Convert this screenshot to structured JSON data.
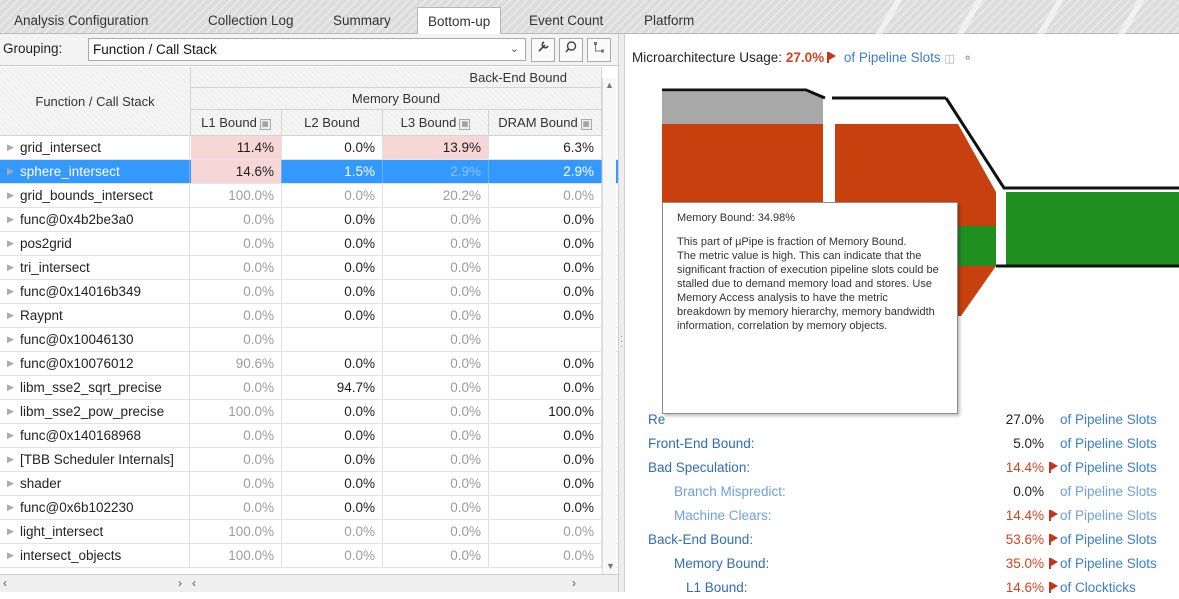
{
  "tabs": [
    {
      "label": "Analysis Configuration",
      "active": false
    },
    {
      "label": "Collection Log",
      "active": false
    },
    {
      "label": "Summary",
      "active": false
    },
    {
      "label": "Bottom-up",
      "active": true
    },
    {
      "label": "Event Count",
      "active": false
    },
    {
      "label": "Platform",
      "active": false
    }
  ],
  "grouping": {
    "label": "Grouping:",
    "value": "Function / Call Stack",
    "buttons": [
      "wrench-icon",
      "search-icon",
      "tree-icon"
    ]
  },
  "grid": {
    "header": {
      "name_col": "Function / Call Stack",
      "group1": "Back-End Bound",
      "group2": "Memory Bound",
      "columns": [
        "L1 Bound",
        "L2 Bound",
        "L3 Bound",
        "DRAM Bound"
      ]
    },
    "rows": [
      {
        "name": "grid_intersect",
        "values": [
          "11.4%",
          "0.0%",
          "13.9%",
          "6.3%"
        ],
        "selected": false,
        "highlight": [
          0,
          2
        ],
        "dim": []
      },
      {
        "name": "sphere_intersect",
        "values": [
          "14.6%",
          "1.5%",
          "2.9%",
          "2.9%"
        ],
        "selected": true,
        "highlight": [
          0
        ],
        "dim": [
          2
        ]
      },
      {
        "name": "grid_bounds_intersect",
        "values": [
          "100.0%",
          "0.0%",
          "20.2%",
          "0.0%"
        ],
        "selected": false,
        "highlight": [],
        "dim": [
          0,
          1,
          2,
          3
        ]
      },
      {
        "name": "func@0x4b2be3a0",
        "values": [
          "0.0%",
          "0.0%",
          "0.0%",
          "0.0%"
        ],
        "selected": false,
        "highlight": [],
        "dim": [
          0,
          2
        ]
      },
      {
        "name": "pos2grid",
        "values": [
          "0.0%",
          "0.0%",
          "0.0%",
          "0.0%"
        ],
        "selected": false,
        "highlight": [],
        "dim": [
          0,
          2
        ]
      },
      {
        "name": "tri_intersect",
        "values": [
          "0.0%",
          "0.0%",
          "0.0%",
          "0.0%"
        ],
        "selected": false,
        "highlight": [],
        "dim": [
          0,
          2
        ]
      },
      {
        "name": "func@0x14016b349",
        "values": [
          "0.0%",
          "0.0%",
          "0.0%",
          "0.0%"
        ],
        "selected": false,
        "highlight": [],
        "dim": [
          0,
          2
        ]
      },
      {
        "name": "Raypnt",
        "values": [
          "0.0%",
          "0.0%",
          "0.0%",
          "0.0%"
        ],
        "selected": false,
        "highlight": [],
        "dim": [
          0,
          2
        ]
      },
      {
        "name": "func@0x10046130",
        "values": [
          "0.0%",
          "",
          "0.0%",
          ""
        ],
        "selected": false,
        "highlight": [],
        "dim": [
          0,
          2
        ]
      },
      {
        "name": "func@0x10076012",
        "values": [
          "90.6%",
          "0.0%",
          "0.0%",
          "0.0%"
        ],
        "selected": false,
        "highlight": [],
        "dim": [
          0,
          2
        ]
      },
      {
        "name": "libm_sse2_sqrt_precise",
        "values": [
          "0.0%",
          "94.7%",
          "0.0%",
          "0.0%"
        ],
        "selected": false,
        "highlight": [],
        "dim": [
          0,
          2
        ]
      },
      {
        "name": "libm_sse2_pow_precise",
        "values": [
          "100.0%",
          "0.0%",
          "0.0%",
          "100.0%"
        ],
        "selected": false,
        "highlight": [],
        "dim": [
          0,
          2
        ]
      },
      {
        "name": "func@0x140168968",
        "values": [
          "0.0%",
          "0.0%",
          "0.0%",
          "0.0%"
        ],
        "selected": false,
        "highlight": [],
        "dim": [
          0,
          2
        ]
      },
      {
        "name": "[TBB Scheduler Internals]",
        "values": [
          "0.0%",
          "0.0%",
          "0.0%",
          "0.0%"
        ],
        "selected": false,
        "highlight": [],
        "dim": [
          0,
          2
        ]
      },
      {
        "name": "shader",
        "values": [
          "0.0%",
          "0.0%",
          "0.0%",
          "0.0%"
        ],
        "selected": false,
        "highlight": [],
        "dim": [
          0,
          2
        ]
      },
      {
        "name": "func@0x6b102230",
        "values": [
          "0.0%",
          "0.0%",
          "0.0%",
          "0.0%"
        ],
        "selected": false,
        "highlight": [],
        "dim": [
          0,
          2
        ]
      },
      {
        "name": "light_intersect",
        "values": [
          "100.0%",
          "0.0%",
          "0.0%",
          "0.0%"
        ],
        "selected": false,
        "highlight": [],
        "dim": [
          0,
          1,
          2,
          3
        ]
      },
      {
        "name": "intersect_objects",
        "values": [
          "100.0%",
          "0.0%",
          "0.0%",
          "0.0%"
        ],
        "selected": false,
        "highlight": [],
        "dim": [
          0,
          1,
          2,
          3
        ]
      }
    ]
  },
  "panel": {
    "title_prefix": "Microarchitecture Usage:",
    "title_value": "27.0%",
    "title_suffix": "of Pipeline Slots",
    "tooltip": {
      "heading": "Memory Bound: 34.98%",
      "body": "This part of µPipe is fraction of Memory Bound.",
      "detail": "The metric value is high. This can indicate that the significant fraction of execution pipeline slots could be stalled due to demand memory load and stores. Use Memory Access analysis to have the metric breakdown by memory hierarchy, memory bandwidth information, correlation by memory objects."
    },
    "metrics": [
      {
        "label": "Re",
        "value": "27.0%",
        "unit": "of Pipeline Slots",
        "flag": false,
        "indent": 0,
        "red": false,
        "light": false
      },
      {
        "label": "Front-End Bound:",
        "value": "5.0%",
        "unit": "of Pipeline Slots",
        "flag": false,
        "indent": 0,
        "red": false,
        "light": false
      },
      {
        "label": "Bad Speculation:",
        "value": "14.4%",
        "unit": "of Pipeline Slots",
        "flag": true,
        "indent": 0,
        "red": true,
        "light": false
      },
      {
        "label": "Branch Mispredict:",
        "value": "0.0%",
        "unit": "of Pipeline Slots",
        "flag": false,
        "indent": 1,
        "red": false,
        "light": true
      },
      {
        "label": "Machine Clears:",
        "value": "14.4%",
        "unit": "of Pipeline Slots",
        "flag": true,
        "indent": 1,
        "red": true,
        "light": true
      },
      {
        "label": "Back-End Bound:",
        "value": "53.6%",
        "unit": "of Pipeline Slots",
        "flag": true,
        "indent": 0,
        "red": true,
        "light": false
      },
      {
        "label": "Memory Bound:",
        "value": "35.0%",
        "unit": "of Pipeline Slots",
        "flag": true,
        "indent": 1,
        "red": true,
        "light": false
      },
      {
        "label": "L1 Bound:",
        "value": "14.6%",
        "unit": "of Clockticks",
        "flag": true,
        "indent": 2,
        "red": true,
        "light": false
      }
    ],
    "colors": {
      "retiring": "#a8a8a8",
      "bound": "#c8400e",
      "good": "#1f8f1f",
      "accent_red": "#d4431c",
      "link_blue": "#3a7fd0"
    }
  }
}
